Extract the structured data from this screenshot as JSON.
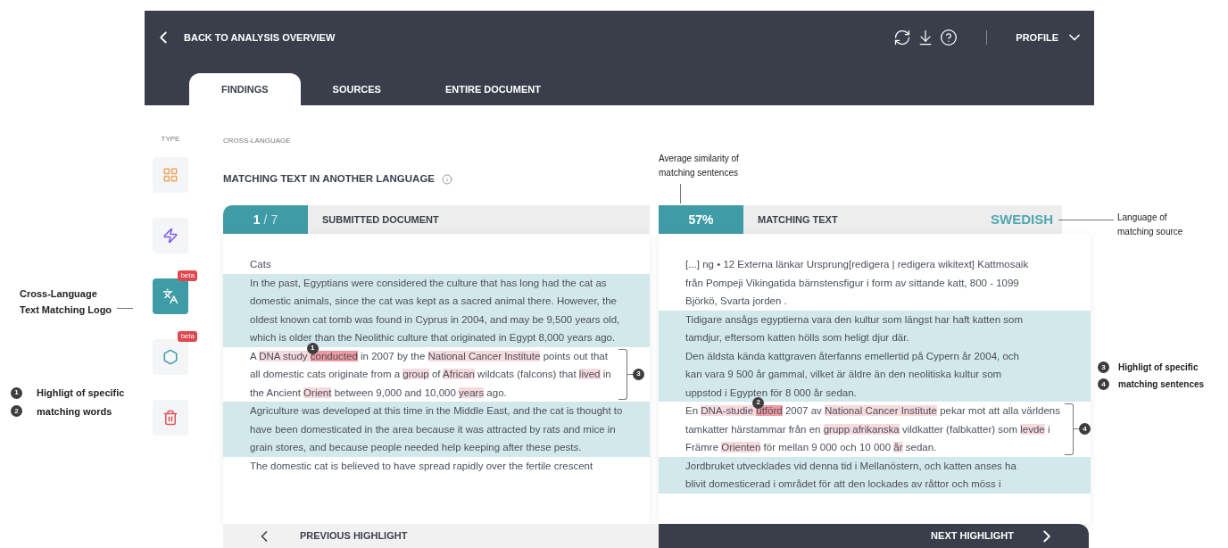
{
  "header": {
    "back_link": "BACK TO ANALYSIS OVERVIEW",
    "profile": "PROFILE"
  },
  "tabs": [
    {
      "label": "FINDINGS",
      "selected": true
    },
    {
      "label": "SOURCES",
      "selected": false
    },
    {
      "label": "ENTIRE DOCUMENT",
      "selected": false
    }
  ],
  "sidebar": {
    "title": "TYPE",
    "items": [
      {
        "kind": "grid",
        "selected": false
      },
      {
        "kind": "bolt",
        "selected": false
      },
      {
        "kind": "cross_language",
        "selected": true,
        "badge": "beta"
      },
      {
        "kind": "hexagon",
        "selected": false,
        "badge": "beta"
      },
      {
        "kind": "trash",
        "selected": false
      }
    ]
  },
  "breadcrumb": "CROSS-LANGUAGE",
  "title": "MATCHING TEXT IN ANOTHER LANGUAGE",
  "left_panel": {
    "counter_current": "1",
    "counter_total": "/ 7",
    "heading": "SUBMITTED DOCUMENT",
    "paragraphs": [
      {
        "kind": "plain",
        "segments": [
          {
            "text": "Cats",
            "kind": "plain"
          }
        ]
      },
      {
        "kind": "match",
        "segments": [
          {
            "text": "In the past, Egyptians were considered the culture that has long had the cat as domestic animals, since the cat was kept as a sacred animal there. However, the oldest known cat tomb was found in Cyprus in 2004, and may be 9,500 years old, which is older than the Neolithic culture that originated in Egypt 8,000 years ago.",
            "kind": "plain"
          }
        ]
      },
      {
        "kind": "focus",
        "bracket": "3",
        "segments": [
          {
            "text": "A ",
            "kind": "plain"
          },
          {
            "text": "DNA study ",
            "kind": "word"
          },
          {
            "text": "conducted",
            "kind": "active",
            "badge": "1"
          },
          {
            "text": " in 2007 by the ",
            "kind": "plain"
          },
          {
            "text": "National Cancer Institute",
            "kind": "word"
          },
          {
            "text": " points out that all domestic cats originate from a ",
            "kind": "plain"
          },
          {
            "text": "group",
            "kind": "word"
          },
          {
            "text": " of ",
            "kind": "plain"
          },
          {
            "text": "African",
            "kind": "word"
          },
          {
            "text": " wildcats (falcons) that ",
            "kind": "plain"
          },
          {
            "text": "lived",
            "kind": "word"
          },
          {
            "text": " in the Ancient ",
            "kind": "plain"
          },
          {
            "text": "Orient",
            "kind": "word"
          },
          {
            "text": " between 9,000 and 10,000 ",
            "kind": "plain"
          },
          {
            "text": "years",
            "kind": "word"
          },
          {
            "text": " ago.",
            "kind": "plain"
          }
        ]
      },
      {
        "kind": "match",
        "segments": [
          {
            "text": "Agriculture was developed at this time in the Middle East, and the cat is thought to have been domesticated in the area because it was attracted by rats and mice in grain stores, and because people needed help keeping after these pests.",
            "kind": "plain"
          }
        ]
      },
      {
        "kind": "plain",
        "segments": [
          {
            "text": "The domestic cat is believed to have spread rapidly over the fertile crescent",
            "kind": "plain"
          }
        ]
      }
    ]
  },
  "right_panel": {
    "similarity": "57%",
    "heading": "MATCHING TEXT",
    "language": "SWEDISH",
    "paragraphs": [
      {
        "kind": "plain",
        "segments": [
          {
            "text": "[...] ng • 12 Externa länkar Ursprung[redigera | redigera wikitext] Kattmosaik från Pompeji Vikingatida bärnstensfigur i form av sittande katt, 800 - 1099 Björkö, Svarta jorden .",
            "kind": "plain"
          }
        ]
      },
      {
        "kind": "match",
        "segments": [
          {
            "text": "Tidigare ansågs egyptierna vara den kultur som längst har haft katten som tamdjur, eftersom katten hölls som heligt djur där.",
            "kind": "plain"
          }
        ]
      },
      {
        "kind": "match",
        "segments": [
          {
            "text": "Den äldsta kända kattgraven återfanns emellertid på Cypern år 2004, och kan vara 9 500 år gammal, vilket är äldre än den neolitiska kultur som uppstod i Egypten för 8 000 år sedan.",
            "kind": "plain"
          }
        ]
      },
      {
        "kind": "focus",
        "bracket": "4",
        "segments": [
          {
            "text": "En ",
            "kind": "plain"
          },
          {
            "text": "DNA-studie ",
            "kind": "word"
          },
          {
            "text": "utförd",
            "kind": "active",
            "badge": "2"
          },
          {
            "text": " 2007 av ",
            "kind": "plain"
          },
          {
            "text": "National Cancer Institute",
            "kind": "word"
          },
          {
            "text": " pekar mot att alla världens tamkatter härstammar från en ",
            "kind": "plain"
          },
          {
            "text": "grupp afrikanska",
            "kind": "word"
          },
          {
            "text": " vildkatter (falbkatter) som ",
            "kind": "plain"
          },
          {
            "text": "levde",
            "kind": "word"
          },
          {
            "text": " i Främre ",
            "kind": "plain"
          },
          {
            "text": "Orienten",
            "kind": "word"
          },
          {
            "text": " för mellan 9 000 och 10 000 ",
            "kind": "plain"
          },
          {
            "text": "år",
            "kind": "word"
          },
          {
            "text": " sedan.",
            "kind": "plain"
          }
        ]
      },
      {
        "kind": "match",
        "segments": [
          {
            "text": "Jordbruket utvecklades vid denna tid i Mellanöstern, och katten anses ha blivit domesticerad i området för att den lockades av råttor och möss i",
            "kind": "plain"
          }
        ]
      }
    ]
  },
  "footer": {
    "previous": "PREVIOUS HIGHLIGHT",
    "next": "NEXT HIGHLIGHT"
  },
  "annotations": {
    "logo": [
      "Cross-Language",
      "Text Matching Logo"
    ],
    "similarity": [
      "Average similarity of",
      "matching sentences"
    ],
    "language": [
      "Language of",
      "matching source"
    ],
    "words": [
      {
        "number": "1",
        "text": "Highligt of specific"
      },
      {
        "number": "2",
        "text": "matching words"
      }
    ],
    "sentences": [
      {
        "number": "3",
        "text": "Highligt of specific"
      },
      {
        "number": "4",
        "text": "matching sentences"
      }
    ]
  }
}
